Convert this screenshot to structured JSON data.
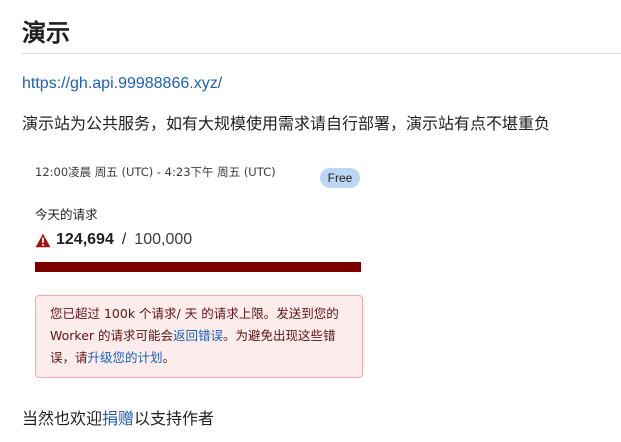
{
  "title": "演示",
  "link": "https://gh.api.99988866.xyz/",
  "description": "演示站为公共服务，如有大规模使用需求请自行部署，演示站有点不堪重负",
  "usage": {
    "range": "12:00凌晨 周五 (UTC) - 4:23下午 周五 (UTC)",
    "plan_badge": "Free",
    "label": "今天的请求",
    "used": "124,694",
    "separator": "/",
    "limit": "100,000",
    "progress_fraction": 1.0,
    "warning_icon": "warning-triangle-icon",
    "colors": {
      "bar": "#7a0000",
      "warning": "#a4140c",
      "badge": "#bcd7f5"
    }
  },
  "alert": {
    "text_1": "您已超过 100k 个请求/ 天 的请求上限。发送到您的 Worker 的请求可能会",
    "link_1": "返回错误",
    "text_2": "。为避免出现这些错误，请",
    "link_2": "升级您的计划",
    "text_3": "。"
  },
  "footer": {
    "text_before": "当然也欢迎",
    "link": "捐赠",
    "text_after": "以支持作者"
  }
}
